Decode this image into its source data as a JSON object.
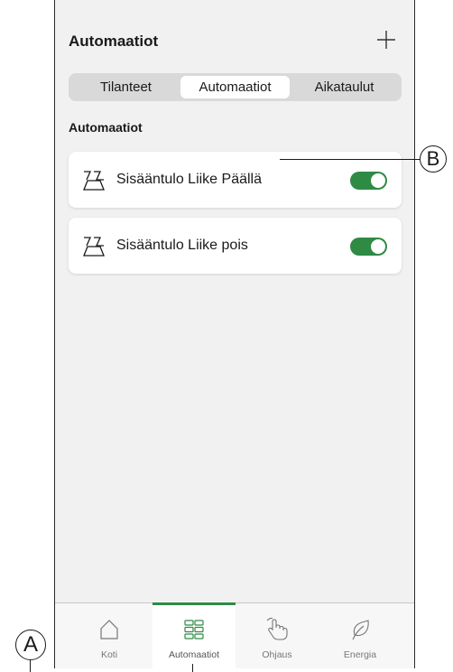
{
  "header": {
    "title": "Automaatiot",
    "add_icon": "plus-icon"
  },
  "segments": [
    {
      "label": "Tilanteet",
      "active": false
    },
    {
      "label": "Automaatiot",
      "active": true
    },
    {
      "label": "Aikataulut",
      "active": false
    }
  ],
  "section_title": "Automaatiot",
  "automations": [
    {
      "label": "Sisääntulo Liike Päällä",
      "icon": "motion-sensor-icon",
      "enabled": true
    },
    {
      "label": "Sisääntulo Liike pois",
      "icon": "motion-sensor-icon",
      "enabled": true
    }
  ],
  "tabbar": {
    "items": [
      {
        "label": "Koti",
        "icon": "home-icon",
        "active": false
      },
      {
        "label": "Automaatiot",
        "icon": "grid-icon",
        "active": true
      },
      {
        "label": "Ohjaus",
        "icon": "hand-swipe-icon",
        "active": false
      },
      {
        "label": "Energia",
        "icon": "leaf-icon",
        "active": false
      }
    ]
  },
  "callouts": {
    "a": "A",
    "b": "B"
  },
  "colors": {
    "accent": "#2f8a44",
    "background": "#f1f1f1",
    "card": "#ffffff"
  }
}
